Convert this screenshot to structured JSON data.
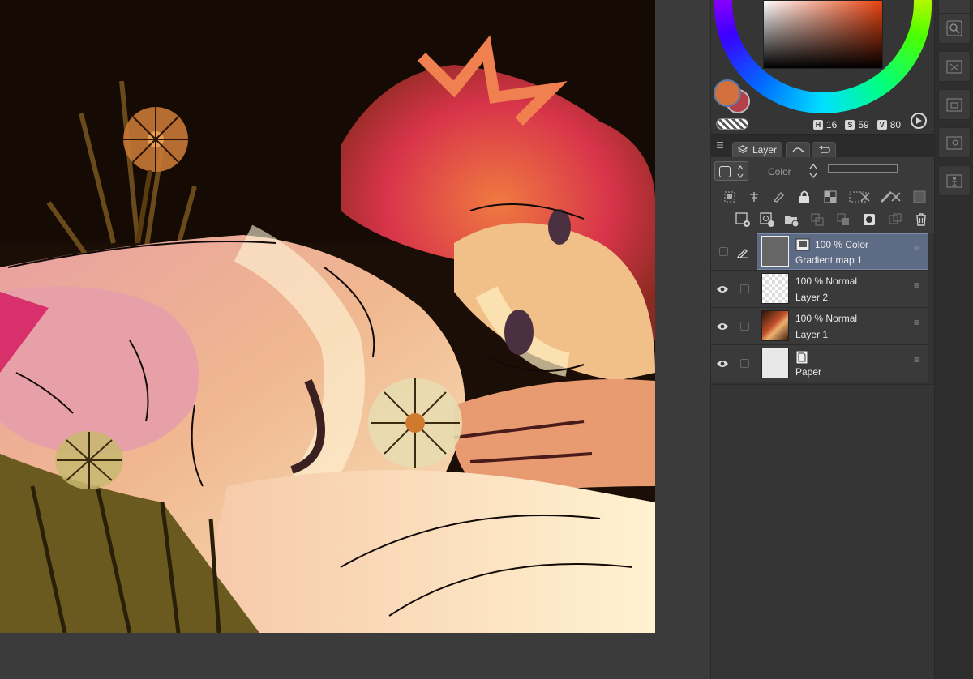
{
  "color": {
    "main_color": "#d2703e",
    "sub_color": "#b4404a",
    "hsv": {
      "h_label": "H",
      "h_value": "16",
      "s_label": "S",
      "s_value": "59",
      "v_label": "V",
      "v_value": "80"
    }
  },
  "tabs": {
    "layer_label": "Layer"
  },
  "layer_props": {
    "blend_mode": "Color"
  },
  "layers": [
    {
      "opacity": "100 %",
      "mode": "Color",
      "name": "Gradient map 1",
      "visible": false,
      "selected": true
    },
    {
      "opacity": "100 %",
      "mode": "Normal",
      "name": "Layer 2",
      "visible": true,
      "selected": false
    },
    {
      "opacity": "100 %",
      "mode": "Normal",
      "name": "Layer 1",
      "visible": true,
      "selected": false
    },
    {
      "opacity": "",
      "mode": "",
      "name": "Paper",
      "visible": true,
      "selected": false
    }
  ]
}
